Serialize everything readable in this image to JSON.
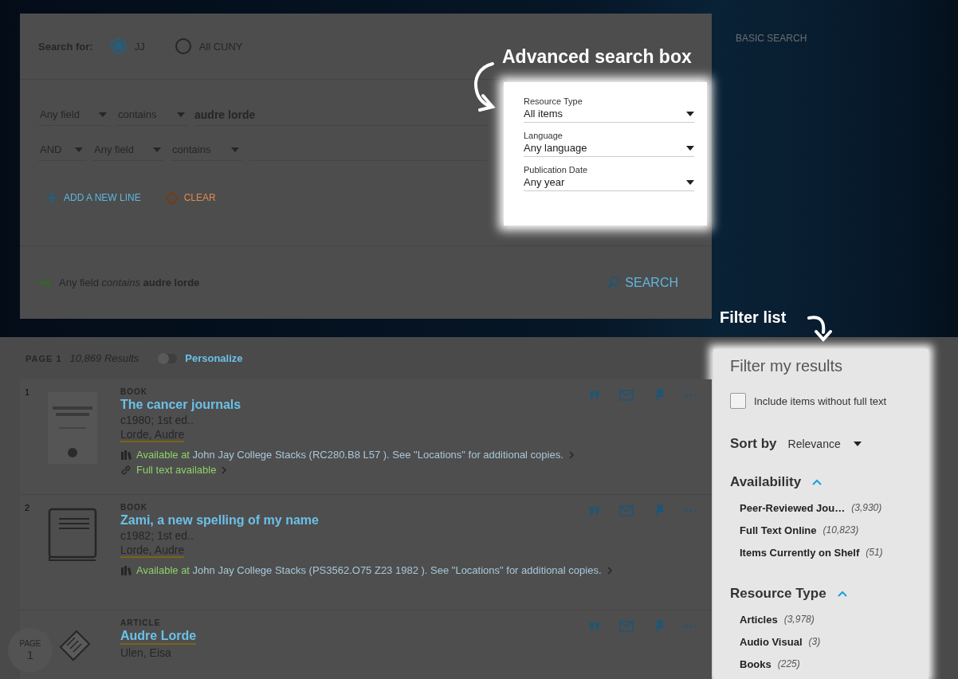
{
  "search_panel": {
    "scope_label": "Search for:",
    "scopes": [
      {
        "label": "JJ",
        "selected": true
      },
      {
        "label": "All CUNY",
        "selected": false
      }
    ],
    "query_lines": [
      {
        "field": "Any field",
        "condition": "contains",
        "value": "audre lorde"
      },
      {
        "operator": "AND",
        "field": "Any field",
        "condition": "contains"
      }
    ],
    "actions": [
      {
        "kind": "add",
        "label": "ADD A NEW LINE"
      },
      {
        "kind": "clear",
        "label": "CLEAR"
      }
    ],
    "filters": [
      {
        "label": "Resource Type",
        "value": "All items"
      },
      {
        "label": "Language",
        "value": "Any language"
      },
      {
        "label": "Publication Date",
        "value": "Any year"
      }
    ],
    "summary": {
      "field": "Any field",
      "condition": "contains",
      "term": "audre lorde"
    },
    "search_button": "SEARCH"
  },
  "basic_search_link": "BASIC SEARCH",
  "annotations": [
    {
      "kind": "search",
      "text": "Advanced search box"
    },
    {
      "kind": "filter",
      "text": "Filter list"
    }
  ],
  "results_header": {
    "page": "PAGE 1",
    "count": "10,869 Results",
    "personalize": {
      "label": "Personalize",
      "on": false
    }
  },
  "results": [
    {
      "number": "1",
      "kind": "cover",
      "type": "BOOK",
      "title": "The cancer journals",
      "title_highlight": false,
      "edition": "c1980; 1st ed..",
      "author": "Lorde, Audre",
      "author_highlight": true,
      "availability": {
        "status": "Available at",
        "location": "John Jay College  Stacks (RC280.B8 L57 ). See \"Locations\" for additional copies."
      },
      "full_text": "Full text available"
    },
    {
      "number": "2",
      "kind": "book",
      "type": "BOOK",
      "title": "Zami, a new spelling of my name",
      "title_highlight": false,
      "edition": "c1982; 1st ed..",
      "author": "Lorde, Audre",
      "author_highlight": true,
      "availability": {
        "status": "Available at",
        "location": "John Jay College  Stacks (PS3562.O75 Z23 1982 ). See \"Locations\" for additional copies."
      }
    },
    {
      "kind": "article",
      "type": "ARTICLE",
      "title": "Audre Lorde",
      "title_highlight": true,
      "author": "Ulen, Eisa",
      "author_highlight": false
    }
  ],
  "page_badge": {
    "label": "PAGE",
    "number": "1"
  },
  "filter_panel": {
    "title": "Filter my results",
    "full_text_option": {
      "label": "Include items without full text",
      "checked": false
    },
    "sort": {
      "label": "Sort by",
      "value": "Relevance"
    },
    "groups": [
      {
        "title": "Availability",
        "expanded": true,
        "items": [
          {
            "label": "Peer-Reviewed Jou…",
            "count": "(3,930)"
          },
          {
            "label": "Full Text Online",
            "count": "(10,823)"
          },
          {
            "label": "Items Currently on Shelf",
            "count": "(51)"
          }
        ]
      },
      {
        "title": "Resource Type",
        "expanded": true,
        "items": [
          {
            "label": "Articles",
            "count": "(3,978)"
          },
          {
            "label": "Audio Visual",
            "count": "(3)"
          },
          {
            "label": "Books",
            "count": "(225)"
          }
        ]
      }
    ]
  }
}
